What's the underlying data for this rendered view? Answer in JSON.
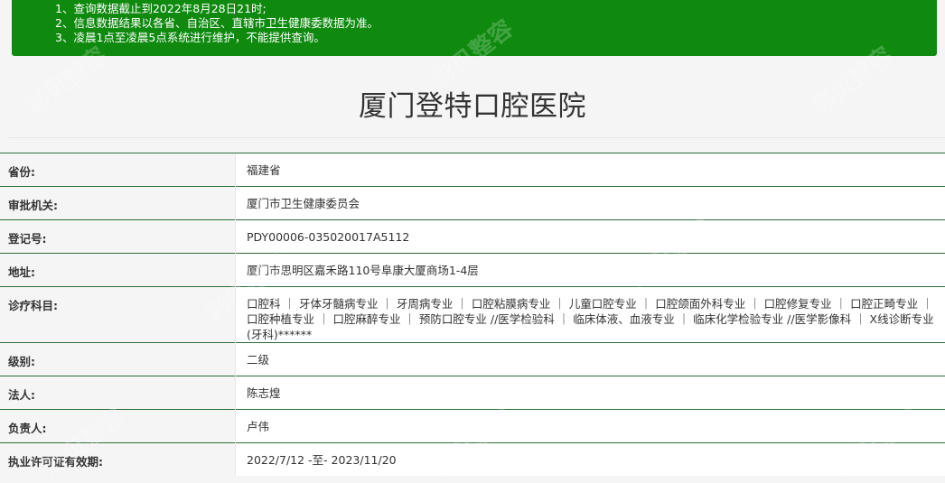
{
  "notice": {
    "lines": [
      "1、查询数据截止到2022年8月28日21时;",
      "2、信息数据结果以各省、自治区、直辖市卫生健康委数据为准。",
      "3、凌晨1点至凌晨5点系统进行维护，不能提供查询。"
    ]
  },
  "page": {
    "title": "厦门登特口腔医院"
  },
  "rows": [
    {
      "label": "省份:",
      "value": "福建省"
    },
    {
      "label": "审批机关:",
      "value": "厦门市卫生健康委员会"
    },
    {
      "label": "登记号:",
      "value": "PDY00006-035020017A5112"
    },
    {
      "label": "地址:",
      "value": "厦门市思明区嘉禾路110号阜康大厦商场1-4层"
    },
    {
      "label": "诊疗科目:",
      "value": "口腔科 ｜ 牙体牙髓病专业 ｜ 牙周病专业 ｜ 口腔粘膜病专业 ｜ 儿童口腔专业 ｜ 口腔颌面外科专业 ｜ 口腔修复专业 ｜ 口腔正畸专业 ｜ 口腔种植专业 ｜ 口腔麻醉专业 ｜ 预防口腔专业 //医学检验科 ｜ 临床体液、血液专业 ｜ 临床化学检验专业 //医学影像科 ｜ X线诊断专业(牙科)******"
    },
    {
      "label": "级别:",
      "value": "二级"
    },
    {
      "label": "法人:",
      "value": "陈志煌"
    },
    {
      "label": "负责人:",
      "value": "卢伟"
    },
    {
      "label": "执业许可证有效期:",
      "value": "2022/7/12 -至- 2023/11/20"
    }
  ],
  "watermark": {
    "text": "彩贝整容"
  }
}
